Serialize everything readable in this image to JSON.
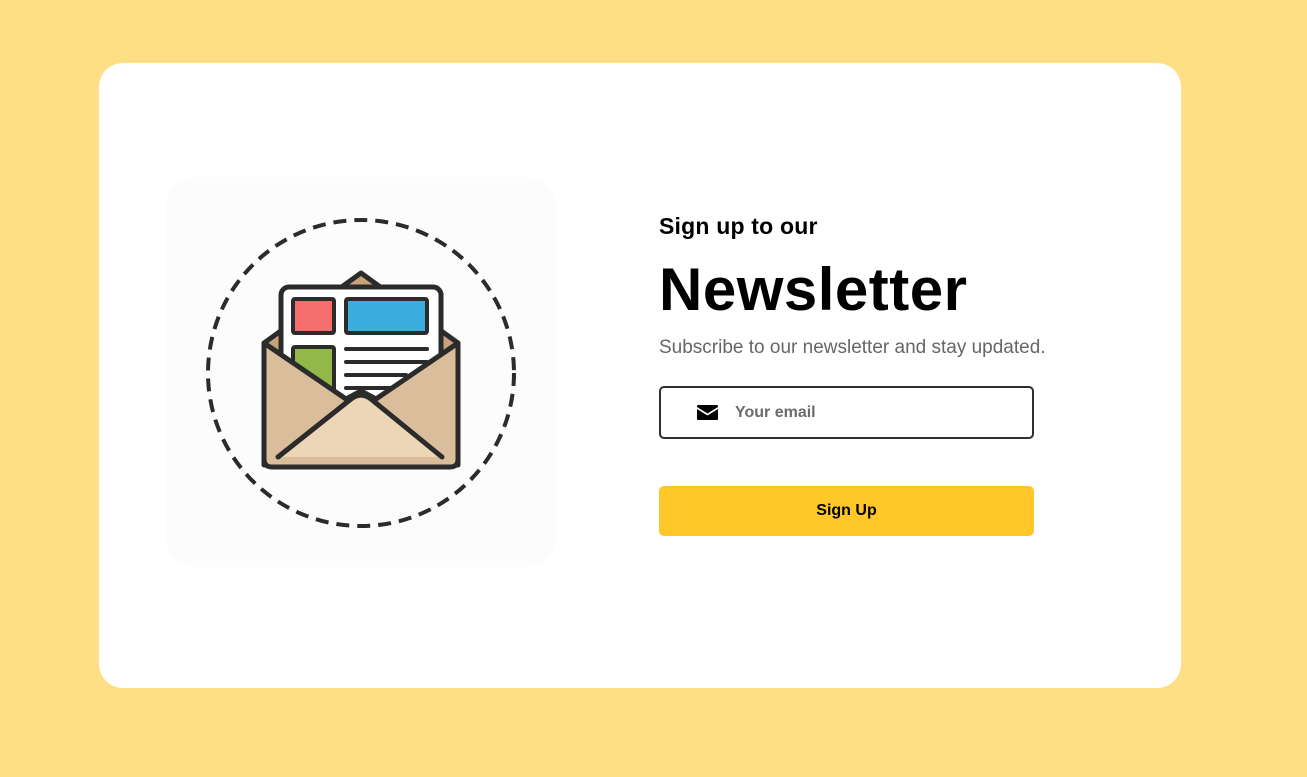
{
  "newsletter": {
    "kicker": "Sign up to our",
    "title": "Newsletter",
    "subtitle": "Subscribe to our newsletter and stay updated.",
    "email_placeholder": "Your email",
    "email_value": "",
    "email_icon": "envelope-icon",
    "button_label": "Sign Up",
    "illustration": "open-envelope-newsletter-icon"
  },
  "colors": {
    "page_background": "#FFDF85",
    "card_background": "#FFFFFF",
    "button_background": "#FFC828",
    "subtitle_text": "#666666",
    "red_block": "#F46E6E",
    "blue_block": "#3AAFDD",
    "green_block": "#92B84A",
    "envelope": "#DABE9C"
  }
}
